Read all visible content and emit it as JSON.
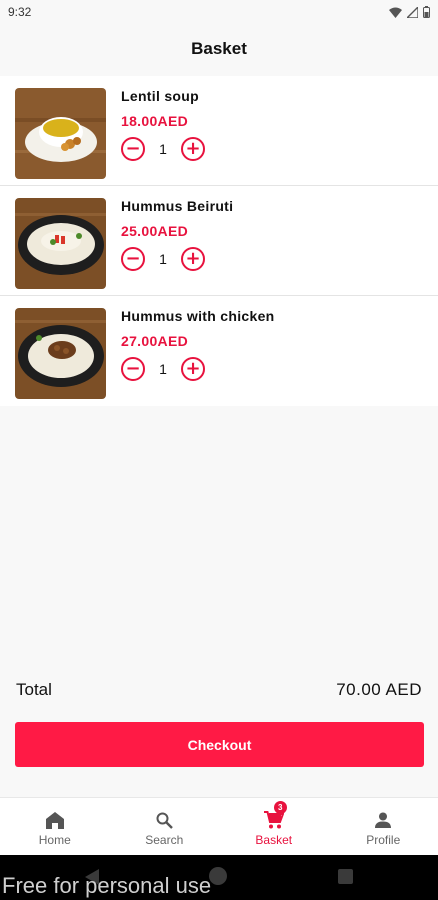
{
  "status_bar": {
    "time": "9:32"
  },
  "header": {
    "title": "Basket"
  },
  "basket": {
    "items": [
      {
        "name": "Lentil soup",
        "price": "18.00AED",
        "quantity": "1",
        "image": "lentil-soup-photo"
      },
      {
        "name": "Hummus Beiruti",
        "price": "25.00AED",
        "quantity": "1",
        "image": "hummus-beiruti-photo"
      },
      {
        "name": "Hummus with chicken",
        "price": "27.00AED",
        "quantity": "1",
        "image": "hummus-chicken-photo"
      }
    ],
    "minus_symbol": "−",
    "plus_symbol": "+"
  },
  "summary": {
    "total_label": "Total",
    "total_value": "70.00 AED"
  },
  "checkout": {
    "label": "Checkout"
  },
  "bottom_nav": {
    "items": [
      {
        "label": "Home",
        "icon": "home-icon"
      },
      {
        "label": "Search",
        "icon": "search-icon"
      },
      {
        "label": "Basket",
        "icon": "cart-icon",
        "badge": "3",
        "active": true
      },
      {
        "label": "Profile",
        "icon": "person-icon"
      }
    ]
  },
  "watermark": "Free for personal use",
  "colors": {
    "accent": "#e8123e",
    "button": "#ff1a45",
    "background": "#f8f8f8"
  }
}
